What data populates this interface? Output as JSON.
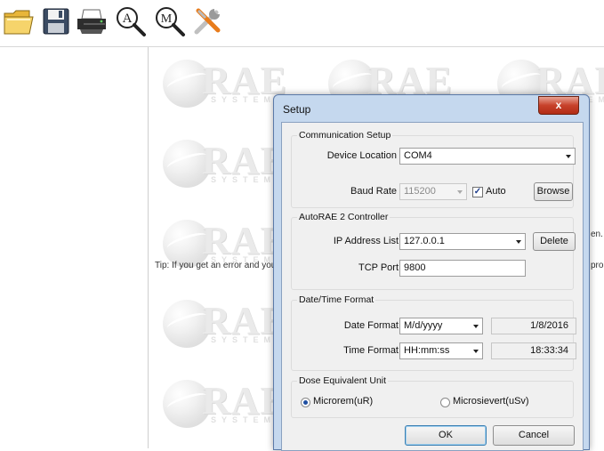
{
  "toolbar": {
    "icons": [
      "open-folder-icon",
      "save-disk-icon",
      "printer-icon",
      "auto-zoom-icon",
      "manual-zoom-icon",
      "tools-icon"
    ],
    "zoom_letters": {
      "auto": "A",
      "manual": "M"
    }
  },
  "background": {
    "logo_text": "RAE",
    "logo_subtext": "SYSTEMS",
    "tip_text": "Tip: If you get an error and you",
    "edge_text_1": "en.",
    "edge_text_2": "pro"
  },
  "dialog": {
    "title": "Setup",
    "close_label": "x",
    "comm": {
      "title": "Communication Setup",
      "device_location_label": "Device Location",
      "device_location_value": "COM4",
      "baud_rate_label": "Baud Rate",
      "baud_rate_value": "115200",
      "auto_label": "Auto",
      "auto_checked": true,
      "browse_label": "Browse"
    },
    "controller": {
      "title": "AutoRAE 2 Controller",
      "ip_label": "IP Address List",
      "ip_value": "127.0.0.1",
      "delete_label": "Delete",
      "tcp_label": "TCP Port",
      "tcp_value": "9800"
    },
    "datetime": {
      "title": "Date/Time Format",
      "date_label": "Date Format",
      "date_format": "M/d/yyyy",
      "date_preview": "1/8/2016",
      "time_label": "Time Format",
      "time_format": "HH:mm:ss",
      "time_preview": "18:33:34"
    },
    "dose": {
      "title": "Dose Equivalent Unit",
      "option1": "Microrem(uR)",
      "option2": "Microsievert(uSv)",
      "selected": "Microrem(uR)"
    },
    "ok_label": "OK",
    "cancel_label": "Cancel"
  }
}
